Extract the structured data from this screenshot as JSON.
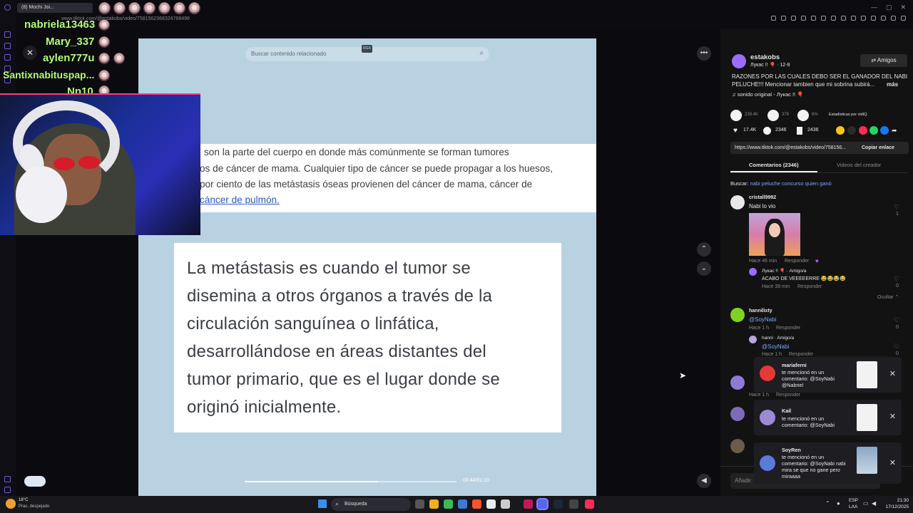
{
  "browser": {
    "tab_title": "(8) Mochi Joi...",
    "url": "www.tiktok.com/@estakobs/video/7581562368324788498"
  },
  "chat": {
    "names": [
      "nabriela13463",
      "Mary_337",
      "aylen777u",
      "Santixnabituspap...",
      "Np10"
    ]
  },
  "video": {
    "search_placeholder": "Buscar contenido relacionado",
    "tag": "RGX",
    "article_lines": [
      "son la parte del cuerpo en donde más comúnmente se forman tumores",
      "os de cáncer de mama. Cualquier tipo de cáncer se puede propagar a los huesos,",
      "por ciento de las metástasis óseas provienen del cáncer de mama, cáncer de",
      "cáncer de pulmón."
    ],
    "quote_lines": [
      "La metástasis es cuando el tumor se",
      "disemina a otros órganos a través de la",
      "circulación sanguínea o linfática,",
      "desarrollándose en áreas distantes del",
      "tumor primario, que es el lugar donde se",
      "originó inicialmente."
    ],
    "time": "00:44/01:10",
    "progress": 0.63
  },
  "panel": {
    "author": "estakobs",
    "author_sub": "Лукас !! 🎈 · 12-8",
    "friends_label": "Amigos",
    "caption_line1": "RAZONES POR LAS CUALES DEBO SER EL GANADOR DEL NABI",
    "caption_line2": "PELUCHE!!! Mencionar tambien que mi sobrina subirá...",
    "more_label": "más",
    "sound": "sonido original - Лукас !! 🎈",
    "plays": "239.4K",
    "shares_count": "378",
    "reposts_pct": "6%",
    "stats_label": "Estadísticas por vidIQ",
    "likes": "17.4K",
    "comments": "2346",
    "saves": "2436",
    "link": "https://www.tiktok.com/@estakobs/video/758156...",
    "copy_link": "Copiar enlace",
    "tab_comments": "Comentarios (2346)",
    "tab_creator": "Videos del creador",
    "search_prefix": "Buscar:",
    "search_term": "nabi peluche concurso quien ganó",
    "comments_list": [
      {
        "user": "cristall9992",
        "text": "Nabi lo vio",
        "time": "Hace 46 min",
        "reply": "Responder",
        "likes": "1"
      },
      {
        "user": "Лукас !! 🎈 · Amigo/a",
        "text": "ACABO DE VEEEEERRE 😂😂😂😂",
        "time": "Hace 39 min",
        "reply": "Responder",
        "likes": "0"
      },
      {
        "user": "hannilixty",
        "text": "@SoyNabi",
        "time": "Hace 1 h",
        "reply": "Responder",
        "likes": "0"
      },
      {
        "user": "hanni · Amigo/a",
        "text": "@SoyNabi",
        "time": "Hace 1 h",
        "reply": "Responder",
        "likes": "0"
      }
    ],
    "hide_label": "Ocultar",
    "extra_time": "Hace 1 h",
    "extra_reply": "Responder",
    "add_comment": "Añadir"
  },
  "notifications": [
    {
      "user": "mariaferni",
      "line1": "te mencionó en un",
      "line2": "comentario: @SoyNabi",
      "line3": "@Nabriel"
    },
    {
      "user": "Kail",
      "line1": "te mencionó en un",
      "line2": "comentario: @SoyNabi",
      "line3": ""
    },
    {
      "user": "SoyRen",
      "line1": "te mencionó en un",
      "line2": "comentario: @SoyNabi nabi",
      "line3": "mira se que no gane pero",
      "line4": "miraaaa"
    }
  ],
  "taskbar": {
    "weather_temp": "18°C",
    "weather_desc": "Prac. despejado",
    "search": "Búsqueda",
    "lang1": "ESP",
    "lang2": "LAA",
    "time": "21:30",
    "date": "17/12/2025"
  }
}
